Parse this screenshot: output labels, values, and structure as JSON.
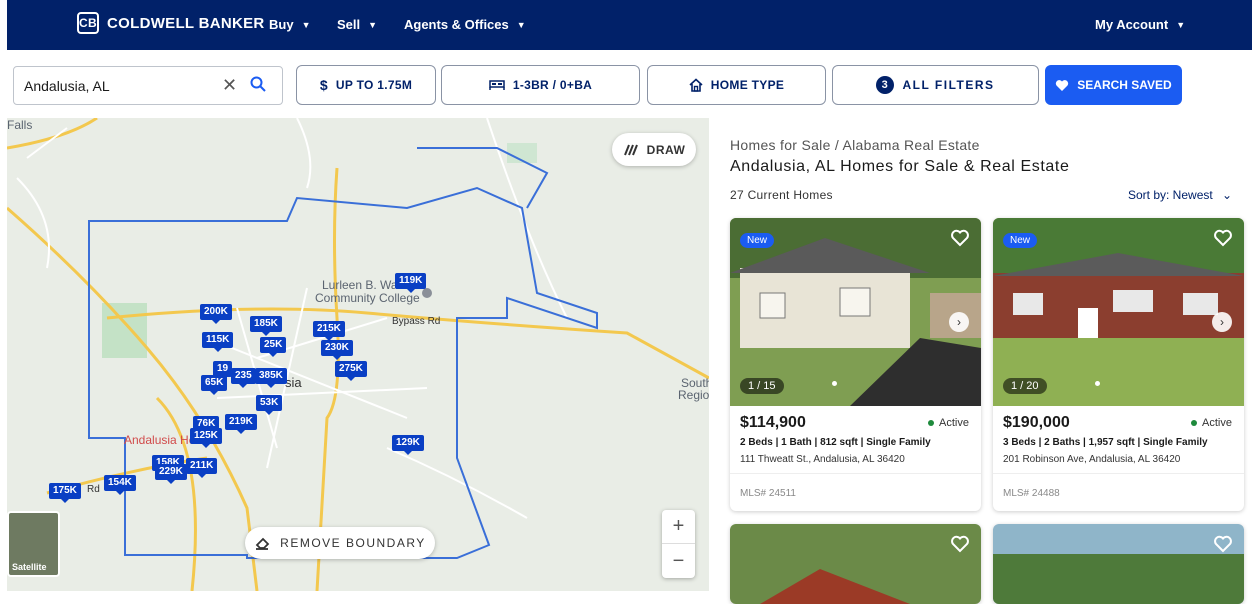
{
  "nav": {
    "brand": "COLDWELL BANKER",
    "buy": "Buy",
    "sell": "Sell",
    "agents": "Agents & Offices",
    "account": "My Account"
  },
  "search": {
    "value": "Andalusia, AL"
  },
  "filters": {
    "price": "UP TO 1.75M",
    "beds": "1-3BR / 0+BA",
    "home_type": "HOME TYPE",
    "all_filters_count": "3",
    "all_filters": "ALL FILTERS",
    "save": "SEARCH SAVED"
  },
  "map": {
    "draw": "DRAW",
    "remove_boundary": "REMOVE BOUNDARY",
    "zoom_in": "+",
    "zoom_out": "−",
    "satellite": "Satellite",
    "labels": {
      "falls": "Falls",
      "college1": "Lurleen B. Wa",
      "college2": "Community College",
      "city": "sia",
      "hospital": "Andalusia He",
      "south": "South",
      "region": "Regio",
      "bypass": "Bypass Rd",
      "rd": "Rd"
    },
    "pins": [
      "119K",
      "200K",
      "185K",
      "215K",
      "115K",
      "25K",
      "230K",
      "19",
      "235",
      "385K",
      "275K",
      "65K",
      "53K",
      "219K",
      "76K",
      "125K",
      "129K",
      "158K",
      "229K",
      "211K",
      "175K",
      "154K"
    ]
  },
  "results": {
    "breadcrumb": "Homes for Sale / Alabama Real Estate",
    "title": "Andalusia, AL Homes for Sale & Real Estate",
    "count": "27 Current Homes",
    "sort": "Sort by: Newest",
    "cards": [
      {
        "badge": "New",
        "counter": "1 / 15",
        "price": "$114,900",
        "status": "Active",
        "specs": "2 Beds | 1 Bath | 812 sqft | Single Family",
        "address": "111 Thweatt St., Andalusia, AL 36420",
        "mls": "MLS# 24511"
      },
      {
        "badge": "New",
        "counter": "1 / 20",
        "price": "$190,000",
        "status": "Active",
        "specs": "3 Beds | 2 Baths | 1,957 sqft | Single Family",
        "address": "201 Robinson Ave, Andalusia, AL 36420",
        "mls": "MLS# 24488"
      }
    ]
  },
  "colors": {
    "brand_navy": "#012169",
    "accent_blue": "#1b5cf2",
    "pin_blue": "#0a3fc4",
    "active_green": "#1e8a3c"
  }
}
